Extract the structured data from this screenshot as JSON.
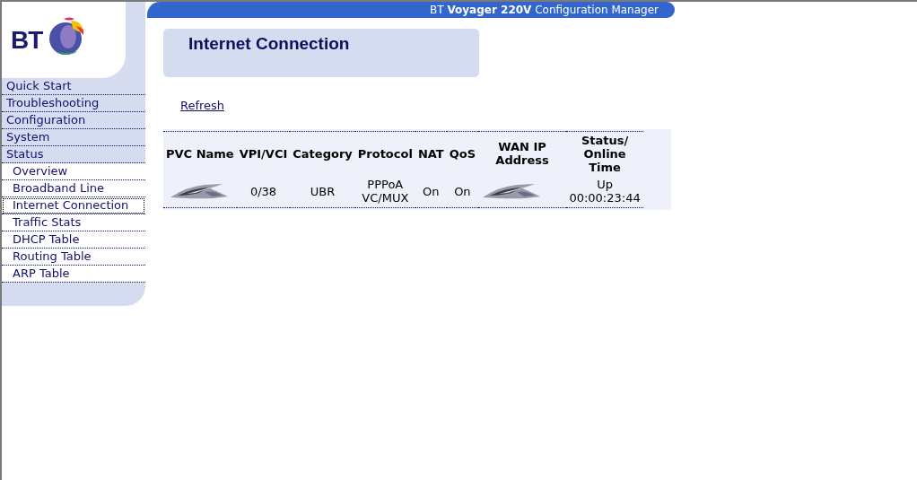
{
  "logo": {
    "text": "BT"
  },
  "header": {
    "title": "BT **Voyager 220V** Configuration Manager"
  },
  "sidebar": {
    "items": [
      {
        "label": "Quick Start",
        "kind": "top",
        "selected": false
      },
      {
        "label": "Troubleshooting",
        "kind": "top",
        "selected": false
      },
      {
        "label": "Configuration",
        "kind": "top",
        "selected": false
      },
      {
        "label": "System",
        "kind": "top",
        "selected": false
      },
      {
        "label": "Status",
        "kind": "top",
        "selected": false
      },
      {
        "label": "Overview",
        "kind": "sub",
        "selected": false
      },
      {
        "label": "Broadband Line",
        "kind": "sub",
        "selected": false
      },
      {
        "label": "Internet Connection",
        "kind": "sub",
        "selected": true
      },
      {
        "label": "Traffic Stats",
        "kind": "sub",
        "selected": false
      },
      {
        "label": "DHCP Table",
        "kind": "sub",
        "selected": false
      },
      {
        "label": "Routing Table",
        "kind": "sub",
        "selected": false
      },
      {
        "label": "ARP Table",
        "kind": "sub",
        "selected": false
      }
    ]
  },
  "page": {
    "title": "Internet Connection",
    "refresh": "Refresh"
  },
  "table": {
    "columns": [
      "PVC Name",
      "VPI/VCI",
      "Category",
      "Protocol",
      "NAT",
      "QoS",
      "WAN IP Address",
      "Status/ Online Time"
    ],
    "rows": [
      [
        {
          "kind": "picture"
        },
        {
          "kind": "text",
          "lines": [
            "0/38"
          ]
        },
        {
          "kind": "text",
          "lines": [
            "UBR"
          ]
        },
        {
          "kind": "text",
          "lines": [
            "PPPoA",
            "VC/MUX"
          ]
        },
        {
          "kind": "text",
          "lines": [
            "On"
          ]
        },
        {
          "kind": "text",
          "lines": [
            "On"
          ]
        },
        {
          "kind": "picture"
        },
        {
          "kind": "text",
          "lines": [
            "Up",
            "00:00:23:44"
          ]
        }
      ]
    ]
  }
}
